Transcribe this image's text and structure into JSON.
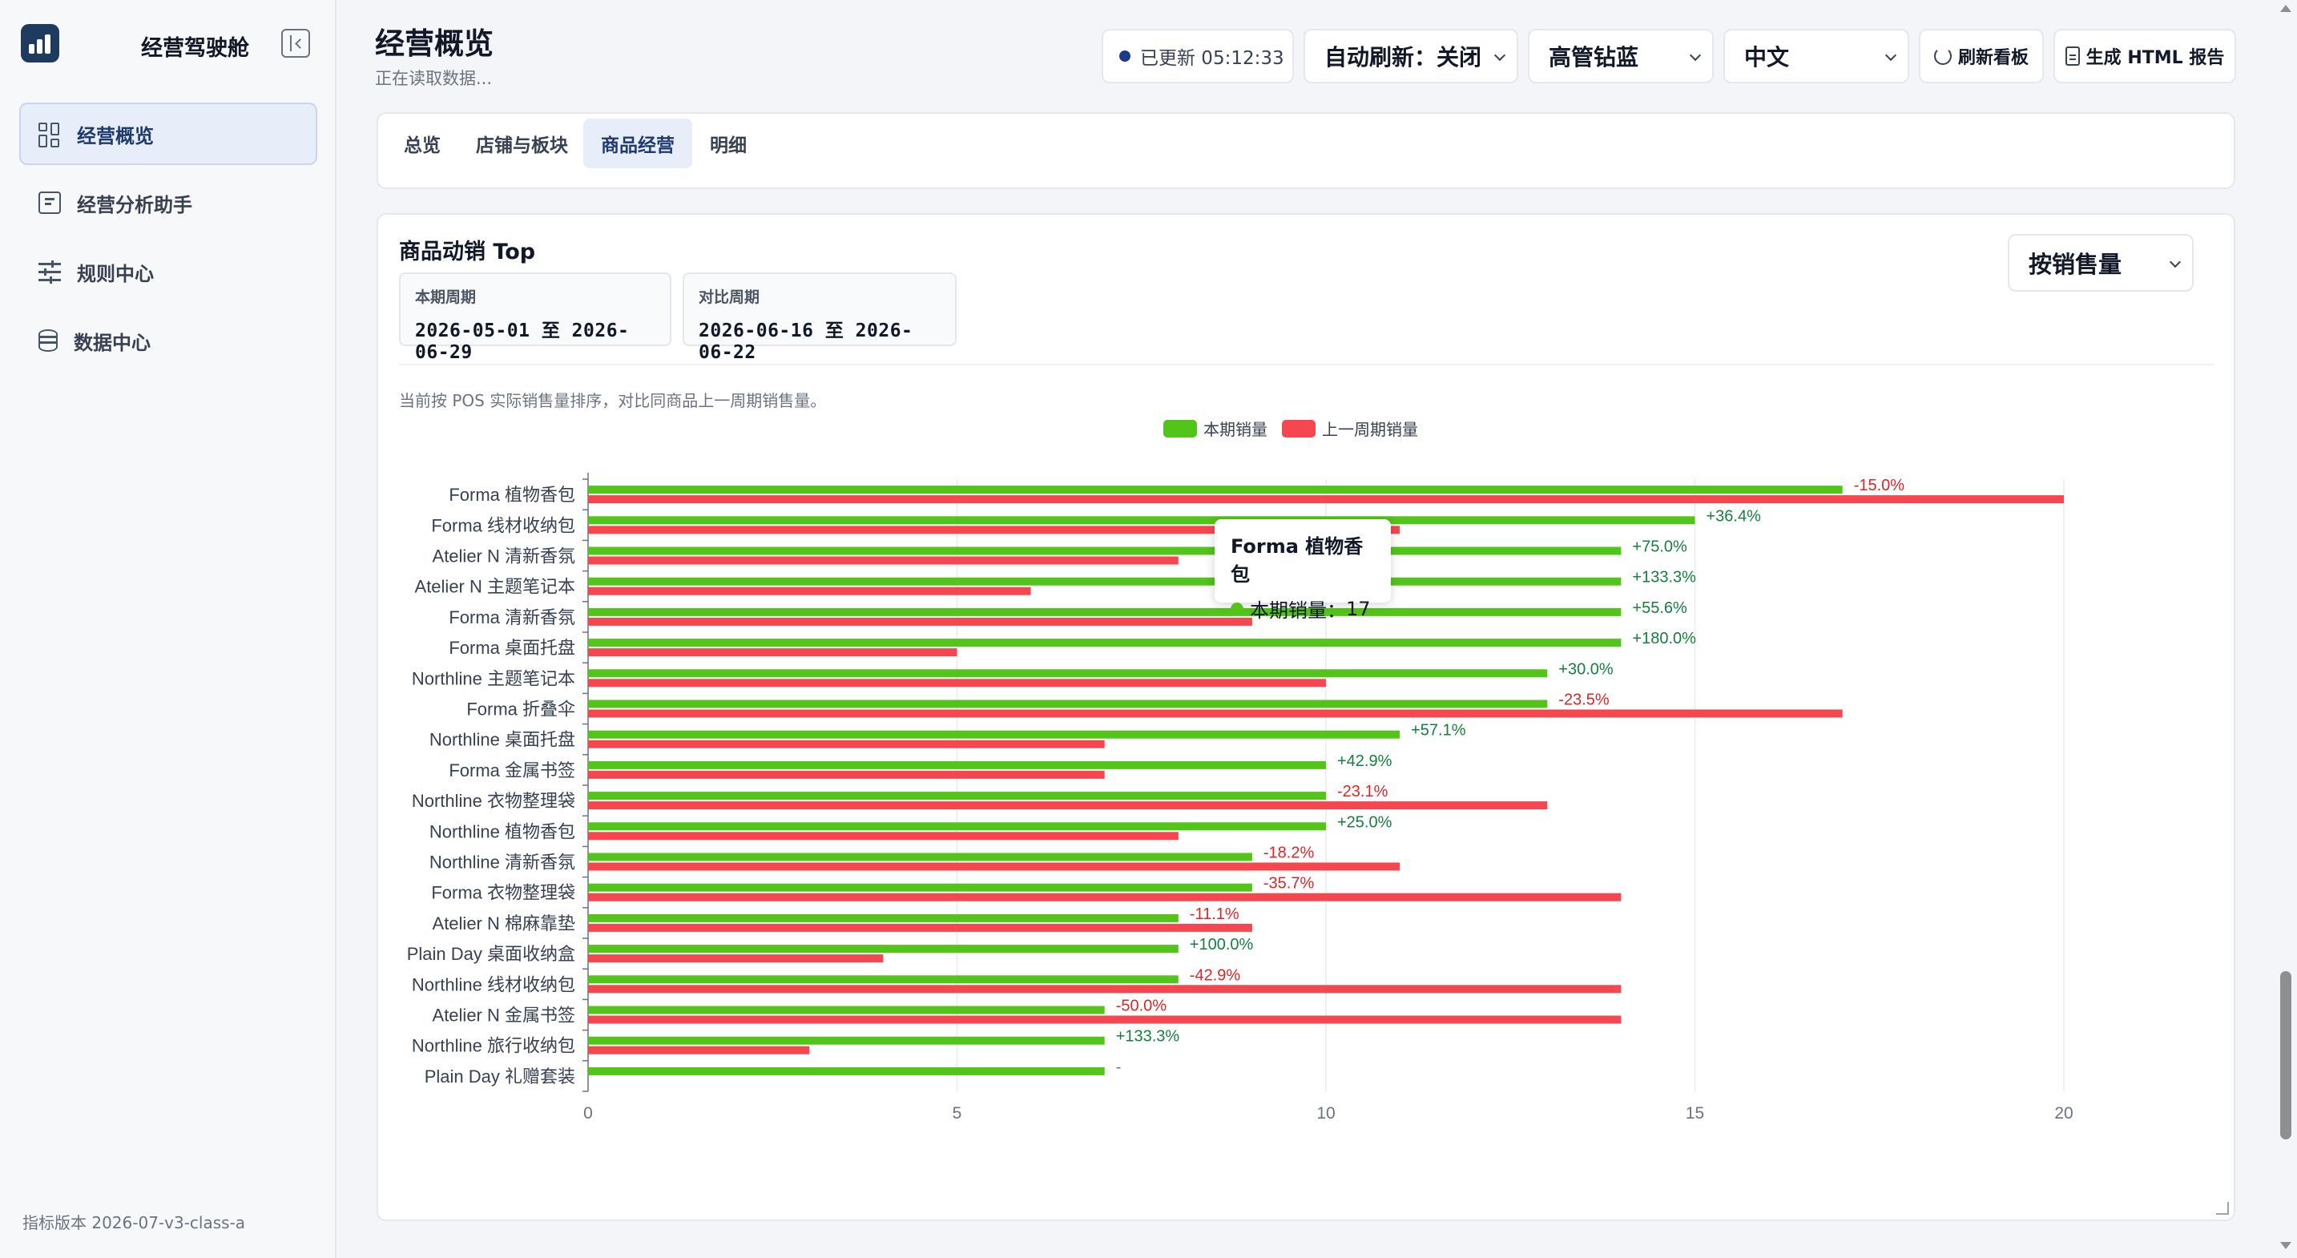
{
  "sidebar": {
    "brand": "经营驾驶舱",
    "items": [
      {
        "label": "经营概览",
        "icon": "dashboard-icon",
        "active": true
      },
      {
        "label": "经营分析助手",
        "icon": "chat-icon",
        "active": false
      },
      {
        "label": "规则中心",
        "icon": "sliders-icon",
        "active": false
      },
      {
        "label": "数据中心",
        "icon": "database-icon",
        "active": false
      }
    ],
    "version": "指标版本 2026-07-v3-class-a"
  },
  "header": {
    "title": "经营概览",
    "subtitle": "正在读取数据...",
    "updated": "已更新 05:12:33",
    "auto_refresh": "自动刷新：关闭",
    "theme": "高管钻蓝",
    "language": "中文",
    "refresh_button": "刷新看板",
    "export_button": "生成 HTML 报告"
  },
  "tabs": [
    {
      "label": "总览",
      "active": false
    },
    {
      "label": "店铺与板块",
      "active": false
    },
    {
      "label": "商品经营",
      "active": true
    },
    {
      "label": "明细",
      "active": false
    }
  ],
  "card": {
    "title": "商品动销 Top",
    "current_period_label": "本期周期",
    "current_period": "2026-05-01 至 2026-06-29",
    "compare_period_label": "对比周期",
    "compare_period": "2026-06-16 至 2026-06-22",
    "sort": "按销售量",
    "note": "当前按 POS 实际销售量排序，对比同商品上一周期销售量。"
  },
  "tooltip": {
    "title": "Forma 植物香包",
    "series": "本期销量",
    "value": "17"
  },
  "colors": {
    "current": "#52c41a",
    "previous": "#f5474f",
    "up": "#15803d",
    "down": "#dc2626",
    "accent": "#1e3a6e"
  },
  "chart_data": {
    "type": "bar",
    "orientation": "horizontal",
    "categories": [
      "Forma 植物香包",
      "Forma 线材收纳包",
      "Atelier N 清新香氛",
      "Atelier N 主题笔记本",
      "Forma 清新香氛",
      "Forma 桌面托盘",
      "Northline 主题笔记本",
      "Forma 折叠伞",
      "Northline 桌面托盘",
      "Forma 金属书签",
      "Northline 衣物整理袋",
      "Northline 植物香包",
      "Northline 清新香氛",
      "Forma 衣物整理袋",
      "Atelier N 棉麻靠垫",
      "Plain Day 桌面收纳盒",
      "Northline 线材收纳包",
      "Atelier N 金属书签",
      "Northline 旅行收纳包",
      "Plain Day 礼赠套装"
    ],
    "series": [
      {
        "name": "本期销量",
        "values": [
          17,
          15,
          14,
          14,
          14,
          14,
          13,
          13,
          11,
          10,
          10,
          10,
          9,
          9,
          8,
          8,
          8,
          7,
          7,
          7
        ]
      },
      {
        "name": "上一周期销量",
        "values": [
          20,
          11,
          8,
          6,
          9,
          5,
          10,
          17,
          7,
          7,
          13,
          8,
          11,
          14,
          9,
          4,
          14,
          14,
          3,
          0
        ]
      }
    ],
    "change_labels": [
      "-15.0%",
      "+36.4%",
      "+75.0%",
      "+133.3%",
      "+55.6%",
      "+180.0%",
      "+30.0%",
      "-23.5%",
      "+57.1%",
      "+42.9%",
      "-23.1%",
      "+25.0%",
      "-18.2%",
      "-35.7%",
      "-11.1%",
      "+100.0%",
      "-42.9%",
      "-50.0%",
      "+133.3%",
      "-"
    ],
    "xlim": [
      0,
      20
    ],
    "xticks": [
      0,
      5,
      10,
      15,
      20
    ],
    "grid": true,
    "legend": "top-center"
  }
}
